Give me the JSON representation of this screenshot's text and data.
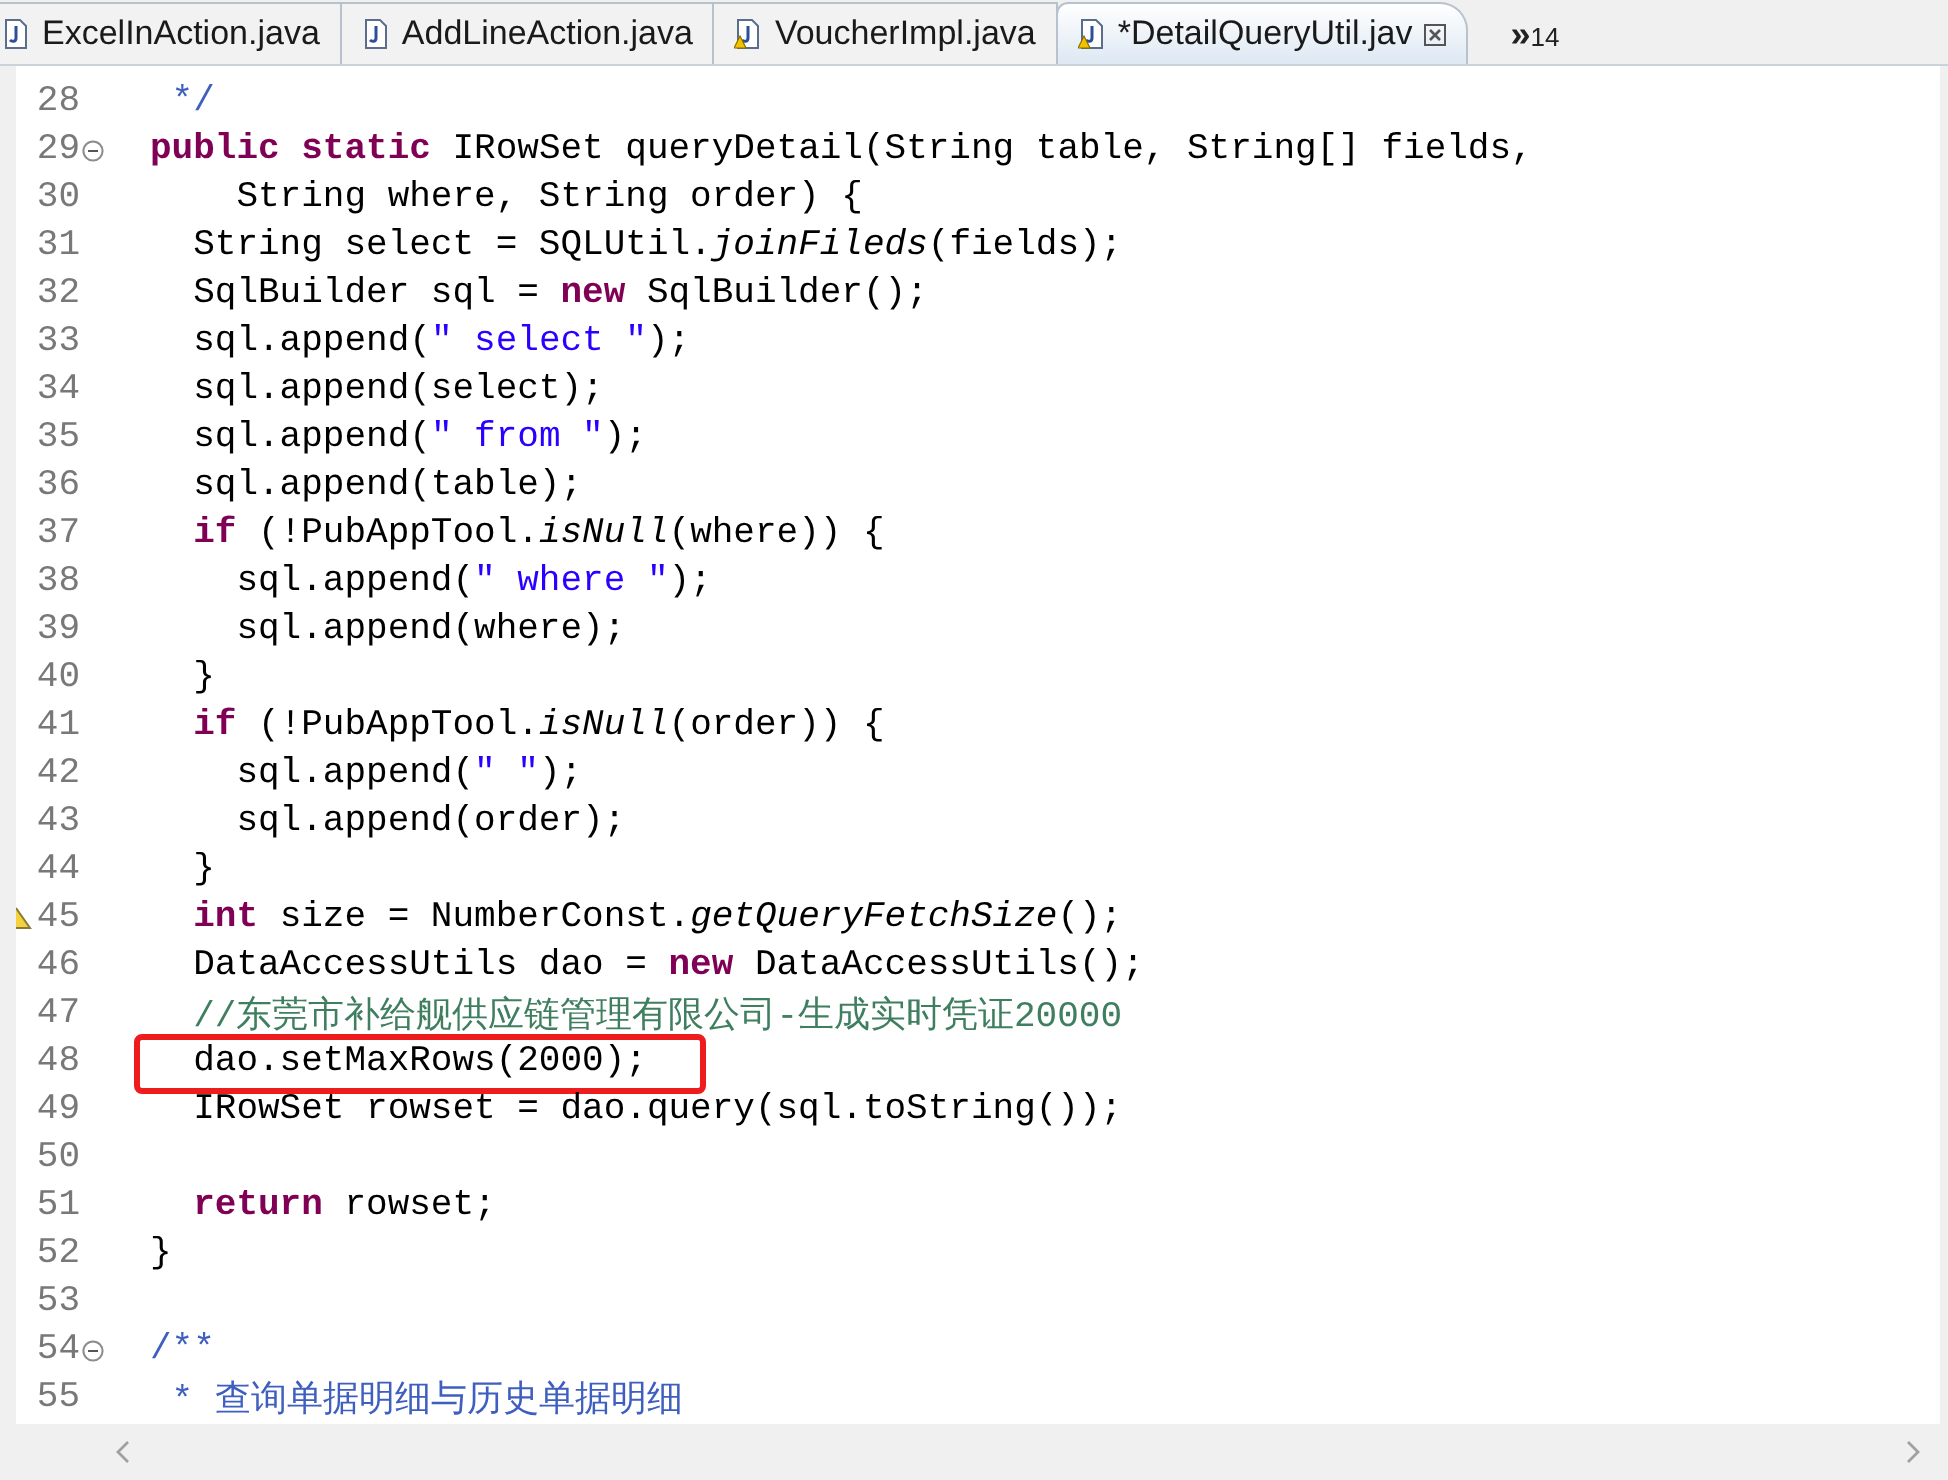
{
  "tabs": [
    {
      "label": "ExcelInAction.java",
      "warning": false,
      "selected": false,
      "closable": false
    },
    {
      "label": "AddLineAction.java",
      "warning": false,
      "selected": false,
      "closable": false
    },
    {
      "label": "VoucherImpl.java",
      "warning": true,
      "selected": false,
      "closable": false
    },
    {
      "label": "*DetailQueryUtil.jav",
      "warning": true,
      "selected": true,
      "closable": true
    }
  ],
  "overflow": {
    "glyph": "»",
    "count": "14"
  },
  "lines": [
    {
      "number": "28",
      "fold": false,
      "warning": false,
      "boxed": false,
      "tokens": [
        {
          "kind": "javadoc",
          "text": " */"
        }
      ]
    },
    {
      "number": "29",
      "fold": true,
      "warning": false,
      "boxed": false,
      "tokens": [
        {
          "kind": "keyword",
          "text": "public"
        },
        {
          "kind": "keyword",
          "text": " static"
        },
        {
          "kind": "plain",
          "text": " IRowSet queryDetail(String table, String[] fields,"
        }
      ]
    },
    {
      "number": "30",
      "fold": false,
      "warning": false,
      "boxed": false,
      "tokens": [
        {
          "kind": "plain",
          "text": "    String where, String order) {"
        }
      ]
    },
    {
      "number": "31",
      "fold": false,
      "warning": false,
      "boxed": false,
      "tokens": [
        {
          "kind": "plain",
          "text": "  String select = SQLUtil."
        },
        {
          "kind": "static",
          "text": "joinFileds"
        },
        {
          "kind": "plain",
          "text": "(fields);"
        }
      ]
    },
    {
      "number": "32",
      "fold": false,
      "warning": false,
      "boxed": false,
      "tokens": [
        {
          "kind": "plain",
          "text": "  SqlBuilder sql = "
        },
        {
          "kind": "keyword",
          "text": "new"
        },
        {
          "kind": "plain",
          "text": " SqlBuilder();"
        }
      ]
    },
    {
      "number": "33",
      "fold": false,
      "warning": false,
      "boxed": false,
      "tokens": [
        {
          "kind": "plain",
          "text": "  sql.append("
        },
        {
          "kind": "string",
          "text": "\" select \""
        },
        {
          "kind": "plain",
          "text": ");"
        }
      ]
    },
    {
      "number": "34",
      "fold": false,
      "warning": false,
      "boxed": false,
      "tokens": [
        {
          "kind": "plain",
          "text": "  sql.append(select);"
        }
      ]
    },
    {
      "number": "35",
      "fold": false,
      "warning": false,
      "boxed": false,
      "tokens": [
        {
          "kind": "plain",
          "text": "  sql.append("
        },
        {
          "kind": "string",
          "text": "\" from \""
        },
        {
          "kind": "plain",
          "text": ");"
        }
      ]
    },
    {
      "number": "36",
      "fold": false,
      "warning": false,
      "boxed": false,
      "tokens": [
        {
          "kind": "plain",
          "text": "  sql.append(table);"
        }
      ]
    },
    {
      "number": "37",
      "fold": false,
      "warning": false,
      "boxed": false,
      "tokens": [
        {
          "kind": "keyword",
          "text": "  if"
        },
        {
          "kind": "plain",
          "text": " (!PubAppTool."
        },
        {
          "kind": "static",
          "text": "isNull"
        },
        {
          "kind": "plain",
          "text": "(where)) {"
        }
      ]
    },
    {
      "number": "38",
      "fold": false,
      "warning": false,
      "boxed": false,
      "tokens": [
        {
          "kind": "plain",
          "text": "    sql.append("
        },
        {
          "kind": "string",
          "text": "\" where \""
        },
        {
          "kind": "plain",
          "text": ");"
        }
      ]
    },
    {
      "number": "39",
      "fold": false,
      "warning": false,
      "boxed": false,
      "tokens": [
        {
          "kind": "plain",
          "text": "    sql.append(where);"
        }
      ]
    },
    {
      "number": "40",
      "fold": false,
      "warning": false,
      "boxed": false,
      "tokens": [
        {
          "kind": "plain",
          "text": "  }"
        }
      ]
    },
    {
      "number": "41",
      "fold": false,
      "warning": false,
      "boxed": false,
      "tokens": [
        {
          "kind": "keyword",
          "text": "  if"
        },
        {
          "kind": "plain",
          "text": " (!PubAppTool."
        },
        {
          "kind": "static",
          "text": "isNull"
        },
        {
          "kind": "plain",
          "text": "(order)) {"
        }
      ]
    },
    {
      "number": "42",
      "fold": false,
      "warning": false,
      "boxed": false,
      "tokens": [
        {
          "kind": "plain",
          "text": "    sql.append("
        },
        {
          "kind": "string",
          "text": "\" \""
        },
        {
          "kind": "plain",
          "text": ");"
        }
      ]
    },
    {
      "number": "43",
      "fold": false,
      "warning": false,
      "boxed": false,
      "tokens": [
        {
          "kind": "plain",
          "text": "    sql.append(order);"
        }
      ]
    },
    {
      "number": "44",
      "fold": false,
      "warning": false,
      "boxed": false,
      "tokens": [
        {
          "kind": "plain",
          "text": "  }"
        }
      ]
    },
    {
      "number": "45",
      "fold": false,
      "warning": true,
      "boxed": false,
      "tokens": [
        {
          "kind": "keyword",
          "text": "  int"
        },
        {
          "kind": "plain",
          "text": " size = NumberConst."
        },
        {
          "kind": "static",
          "text": "getQueryFetchSize"
        },
        {
          "kind": "plain",
          "text": "();"
        }
      ]
    },
    {
      "number": "46",
      "fold": false,
      "warning": false,
      "boxed": false,
      "tokens": [
        {
          "kind": "plain",
          "text": "  DataAccessUtils dao = "
        },
        {
          "kind": "keyword",
          "text": "new"
        },
        {
          "kind": "plain",
          "text": " DataAccessUtils();"
        }
      ]
    },
    {
      "number": "47",
      "fold": false,
      "warning": false,
      "boxed": false,
      "tokens": [
        {
          "kind": "comment",
          "text": "  //东莞市补给舰供应链管理有限公司-生成实时凭证20000"
        }
      ]
    },
    {
      "number": "48",
      "fold": false,
      "warning": false,
      "boxed": true,
      "tokens": [
        {
          "kind": "plain",
          "text": "  dao.setMaxRows(2000);"
        }
      ]
    },
    {
      "number": "49",
      "fold": false,
      "warning": false,
      "boxed": false,
      "tokens": [
        {
          "kind": "plain",
          "text": "  IRowSet rowset = dao.query(sql.toString());"
        }
      ]
    },
    {
      "number": "50",
      "fold": false,
      "warning": false,
      "boxed": false
    },
    {
      "number": "51",
      "fold": false,
      "warning": false,
      "boxed": false,
      "tokens": [
        {
          "kind": "keyword",
          "text": "  return"
        },
        {
          "kind": "plain",
          "text": " rowset;"
        }
      ]
    },
    {
      "number": "52",
      "fold": false,
      "warning": false,
      "boxed": false,
      "tokens": [
        {
          "kind": "plain",
          "text": "}"
        }
      ]
    },
    {
      "number": "53",
      "fold": false,
      "warning": false,
      "boxed": false
    },
    {
      "number": "54",
      "fold": true,
      "warning": false,
      "boxed": false,
      "tokens": [
        {
          "kind": "javadoc",
          "text": "/**"
        }
      ]
    },
    {
      "number": "55",
      "fold": false,
      "warning": false,
      "boxed": false,
      "tokens": [
        {
          "kind": "javadoc",
          "text": " * 查询单据明细与历史单据明细"
        }
      ]
    }
  ]
}
